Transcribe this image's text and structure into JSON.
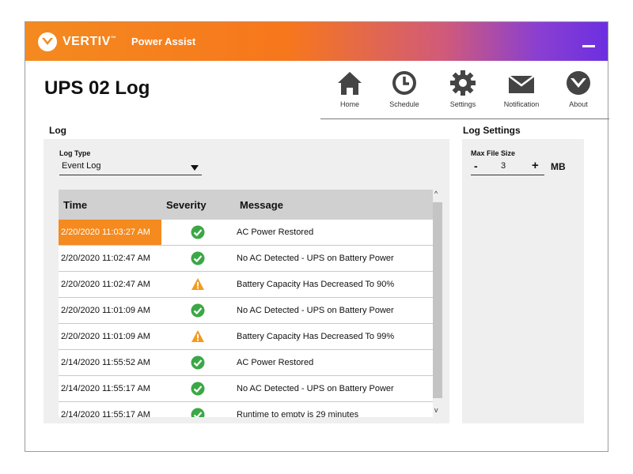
{
  "titlebar": {
    "brand": "VERTIV",
    "brand_mark": "™",
    "app_name": "Power Assist"
  },
  "page_title": "UPS 02 Log",
  "nav": {
    "items": [
      {
        "label": "Home",
        "icon": "home-icon"
      },
      {
        "label": "Schedule",
        "icon": "clock-icon"
      },
      {
        "label": "Settings",
        "icon": "gear-icon"
      },
      {
        "label": "Notification",
        "icon": "envelope-icon"
      },
      {
        "label": "About",
        "icon": "vertiv-logo-icon"
      }
    ]
  },
  "log": {
    "title": "Log",
    "log_type_label": "Log Type",
    "log_type_value": "Event Log",
    "columns": [
      "Time",
      "Severity",
      "Message"
    ],
    "rows": [
      {
        "time": "2/20/2020 11:03:27 AM",
        "severity": "ok",
        "message": "AC Power Restored",
        "selected": true
      },
      {
        "time": "2/20/2020 11:02:47 AM",
        "severity": "ok",
        "message": "No AC Detected - UPS on Battery Power"
      },
      {
        "time": "2/20/2020 11:02:47 AM",
        "severity": "warning",
        "message": "Battery Capacity Has Decreased To 90%"
      },
      {
        "time": "2/20/2020 11:01:09 AM",
        "severity": "ok",
        "message": "No AC Detected - UPS on Battery Power"
      },
      {
        "time": "2/20/2020 11:01:09 AM",
        "severity": "warning",
        "message": "Battery Capacity Has Decreased To 99%"
      },
      {
        "time": "2/14/2020 11:55:52 AM",
        "severity": "ok",
        "message": "AC Power Restored"
      },
      {
        "time": "2/14/2020 11:55:17 AM",
        "severity": "ok",
        "message": "No AC Detected - UPS on Battery Power"
      },
      {
        "time": "2/14/2020 11:55:17 AM",
        "severity": "ok",
        "message": "Runtime to empty is 29 minutes"
      }
    ]
  },
  "log_settings": {
    "title": "Log Settings",
    "max_file_size_label": "Max File Size",
    "minus": "-",
    "value": "3",
    "plus": "+",
    "unit": "MB"
  },
  "colors": {
    "accent_orange": "#f58a1f",
    "accent_purple": "#6c2fe0",
    "ok_green": "#3aa845",
    "warning_orange": "#f59a1f"
  }
}
